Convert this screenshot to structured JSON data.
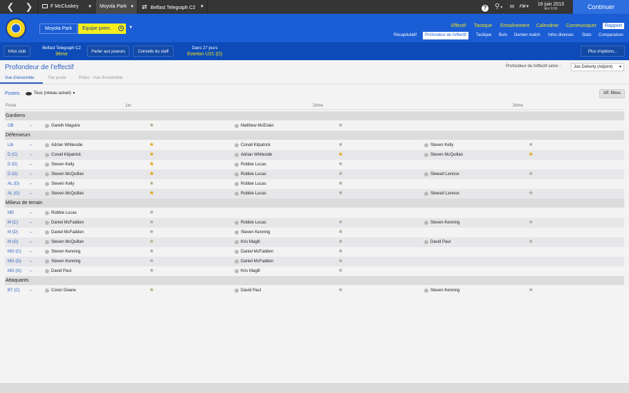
{
  "topbar": {
    "back_icon": "chevron-left-icon",
    "forward_icon": "chevron-right-icon",
    "manager": "F McCluskey",
    "club": "Moyola Park",
    "competition": "Belfast Telegraph C2",
    "help_icon": "help-icon",
    "search_icon": "search-icon",
    "fm_label": "FM",
    "date": "16 juin 2013",
    "day_time": "dim 9:00",
    "continue_label": "Continuer"
  },
  "header": {
    "team_name": "Moyola Park",
    "squad": "Équipe prem.",
    "menu1": [
      "Effectif",
      "Tactique",
      "Entraînement",
      "Calendrier",
      "Communiquer",
      "Rapport"
    ],
    "menu2": [
      "Récapitulatif",
      "Profondeur de l'effectif",
      "Tactique",
      "Buts",
      "Dernier match",
      "Infos diverses",
      "Stats",
      "Comparaison"
    ]
  },
  "subbar": {
    "infos_club": "Infos club",
    "league": "Belfast Telegraph C2",
    "position": "9ème",
    "parler": "Parler aux joueurs",
    "conseils": "Conseils du staff",
    "next_in": "Dans 27 jours",
    "next_match": "Everton U21 (D)",
    "options": "Plus d'options..."
  },
  "page": {
    "title": "Profondeur de l'effectif",
    "selon_label": "Profondeur de l'effectif selon :",
    "selon_value": "Joe Doherty (Adjoint)",
    "tabs": [
      "Vue d'ensemble",
      "Par poste",
      "Rôles - Vue d'ensemble"
    ],
    "postes": "Postes",
    "filter_value": "Tous (niveau actuel)",
    "aff_filtres": "Aff. filtres",
    "col_postes": "Poste",
    "col_1": "1er",
    "col_2": "2ème",
    "col_3": "3ème"
  },
  "depth": [
    {
      "section": "Gardiens"
    },
    {
      "pos": "GB",
      "p1": "Gareth Maguire",
      "s1": 4,
      "p2": "Matthew McErlain",
      "s2": 1,
      "p3": "",
      "s3": null
    },
    {
      "section": "Défenseurs"
    },
    {
      "pos": "Lib",
      "p1": "Adrian Whiteside",
      "s1": 5,
      "p2": "Conall Kilpatrick",
      "s2": 1,
      "p3": "Steven Kelly",
      "s3": 1
    },
    {
      "pos": "D (C)",
      "p1": "Conall Kilpatrick",
      "s1": 5,
      "p2": "Adrian Whiteside",
      "s2": 5,
      "p3": "Steven McQuillan",
      "s3": 5
    },
    {
      "pos": "D (D)",
      "p1": "Steven Kelly",
      "s1": 4.5,
      "p2": "Robbie Lucas",
      "s2": 1,
      "p3": "",
      "s3": null
    },
    {
      "pos": "D (G)",
      "p1": "Steven McQuillan",
      "s1": 4.5,
      "p2": "Robbie Lucas",
      "s2": 1,
      "p3": "Stewart Lennox",
      "s3": 1
    },
    {
      "pos": "AL (D)",
      "p1": "Steven Kelly",
      "s1": 4,
      "p2": "Robbie Lucas",
      "s2": 0.5,
      "p3": "",
      "s3": null
    },
    {
      "pos": "AL (G)",
      "p1": "Steven McQuillan",
      "s1": 4.5,
      "p2": "Robbie Lucas",
      "s2": 0.5,
      "p3": "Stewart Lennox",
      "s3": 0.5
    },
    {
      "section": "Milieux de terrain"
    },
    {
      "pos": "MD",
      "p1": "Robbie Lucas",
      "s1": 1,
      "p2": "",
      "s2": null,
      "p3": "",
      "s3": null
    },
    {
      "pos": "M (C)",
      "p1": "Daniel McFadden",
      "s1": 1,
      "p2": "Robbie Lucas",
      "s2": 1,
      "p3": "Steven Kenning",
      "s3": 1
    },
    {
      "pos": "M (D)",
      "p1": "Daniel McFadden",
      "s1": 1,
      "p2": "Steven Kenning",
      "s2": 0.5,
      "p3": "",
      "s3": null
    },
    {
      "pos": "M (G)",
      "p1": "Steven McQuillan",
      "s1": 4,
      "p2": "Kris Magill",
      "s2": 2,
      "p3": "David Paul",
      "s3": 2
    },
    {
      "pos": "MO (C)",
      "p1": "Steven Kenning",
      "s1": 1,
      "p2": "Daniel McFadden",
      "s2": 0.5,
      "p3": "",
      "s3": null
    },
    {
      "pos": "MO (D)",
      "p1": "Steven Kenning",
      "s1": 1,
      "p2": "Daniel McFadden",
      "s2": 0.5,
      "p3": "",
      "s3": null
    },
    {
      "pos": "MO (G)",
      "p1": "David Paul",
      "s1": 2,
      "p2": "Kris Magill",
      "s2": 1,
      "p3": "",
      "s3": null
    },
    {
      "section": "Attaquants"
    },
    {
      "pos": "BT (C)",
      "p1": "Conor Deane",
      "s1": 4,
      "p2": "David Paul",
      "s2": 1,
      "p3": "Steven Kenning",
      "s3": 1
    }
  ],
  "colors": {
    "brand_blue": "#1b5dd4",
    "accent_yellow": "#f5ee1c",
    "star_on": "#e3a714",
    "continue": "#2e6fe0"
  }
}
